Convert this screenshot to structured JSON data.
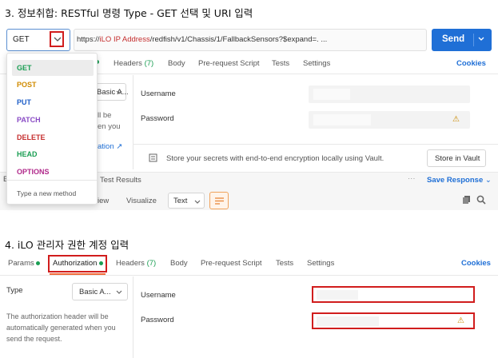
{
  "section1": {
    "title": "3. 정보취합: RESTful 명령 Type - GET 선택 및 URI 입력",
    "method": "GET",
    "url_prefix": "https://",
    "url_variable": "iLO IP Address",
    "url_suffix": "/redfish/v1/Chassis/1/FallbackSensors?$expand=. ...",
    "send_label": "Send",
    "tabs": [
      {
        "label": "Headers",
        "count": "(7)"
      },
      {
        "label": "Body"
      },
      {
        "label": "Pre-request Script"
      },
      {
        "label": "Tests"
      },
      {
        "label": "Settings"
      }
    ],
    "tab_active_dot_label": "",
    "cookies_label": "Cookies",
    "auth_type_value": "Basic A...",
    "username_label": "Username",
    "password_label": "Password",
    "bg_text_lines": [
      "ll be",
      "en you"
    ],
    "bg_link": "ation ↗",
    "vault_text": "Store your secrets with end-to-end encryption locally using Vault.",
    "vault_button": "Store in Vault",
    "response_tabs": [
      "Test Results"
    ],
    "save_response": "Save Response",
    "response_view_fragment": "iew",
    "visualize_label": "Visualize",
    "format_select": "Text",
    "dropdown": {
      "items": [
        {
          "label": "GET",
          "color": "#1a9e53",
          "selected": true
        },
        {
          "label": "POST",
          "color": "#d08b00"
        },
        {
          "label": "PUT",
          "color": "#1f5fc8"
        },
        {
          "label": "PATCH",
          "color": "#8a4cc5"
        },
        {
          "label": "DELETE",
          "color": "#c62f2f"
        },
        {
          "label": "HEAD",
          "color": "#1a9e53"
        },
        {
          "label": "OPTIONS",
          "color": "#b0288a"
        }
      ],
      "type_new": "Type a new method"
    }
  },
  "section2": {
    "title": "4. iLO 관리자 권한 계정 입력",
    "tabs": [
      {
        "label": "Params",
        "dot": true
      },
      {
        "label": "Authorization",
        "dot": true
      },
      {
        "label": "Headers",
        "count": "(7)"
      },
      {
        "label": "Body"
      },
      {
        "label": "Pre-request Script"
      },
      {
        "label": "Tests"
      },
      {
        "label": "Settings"
      }
    ],
    "cookies_label": "Cookies",
    "type_label": "Type",
    "type_value": "Basic A...",
    "description": "The authorization header will be automatically generated when you send the request.",
    "description_lines": [
      "The authorization header will be",
      "automatically generated when you",
      "send the request."
    ],
    "username_label": "Username",
    "password_label": "Password"
  },
  "colors": {
    "send": "#1f6fd6",
    "highlight_red": "#d11d1d",
    "dot_green": "#1a9e53"
  }
}
